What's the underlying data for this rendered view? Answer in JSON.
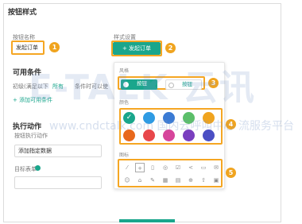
{
  "section_button_style": "按钮样式",
  "button_name": {
    "label": "按钮名称",
    "value": "发起订单"
  },
  "style_settings": {
    "label": "样式设置",
    "button_label": "+ 发起订单"
  },
  "panel": {
    "style_label": "风格",
    "style_options": [
      "按钮",
      "按钮"
    ],
    "color_label": "颜色",
    "icon_label": "图标"
  },
  "conditions": {
    "title": "可用条件",
    "row_text": "初级(满足以下",
    "any": "所有",
    "rule_text": "条件时可以使",
    "add_link": "+ 添加可用条件"
  },
  "execute": {
    "title": "执行动作",
    "label": "按钮执行动作",
    "value": "添加指定数据"
  },
  "trigger_form": {
    "label": "目标表单"
  },
  "badges": [
    "1",
    "2",
    "3",
    "4",
    "5"
  ],
  "colors": {
    "row1": [
      "#1aa68c",
      "#2f9be3",
      "#3b7bd4",
      "#5cbf6a",
      "#f0a41f"
    ],
    "row2": [
      "#e8681c",
      "#e8474b",
      "#d6459b",
      "#7a3fbf",
      "#4b4fc4"
    ],
    "accent": "#1aa68c",
    "badge": "#f0a41f",
    "highlight": "#f5a623"
  },
  "icons": [
    "pencil-icon",
    "plus-box-icon",
    "file-icon",
    "check-circle-icon",
    "check-square-icon",
    "share-icon",
    "print-icon",
    "mail-icon",
    "smile-icon",
    "home-icon",
    "edit-icon",
    "calendar-icon",
    "document-icon",
    "plus-circle-icon",
    "upload-icon",
    "calendar-icon-2"
  ],
  "watermark": {
    "big": "E-TALK 云讯",
    "url": "www.cndctalk.com 国内云呼叫中心 流服务平台"
  }
}
